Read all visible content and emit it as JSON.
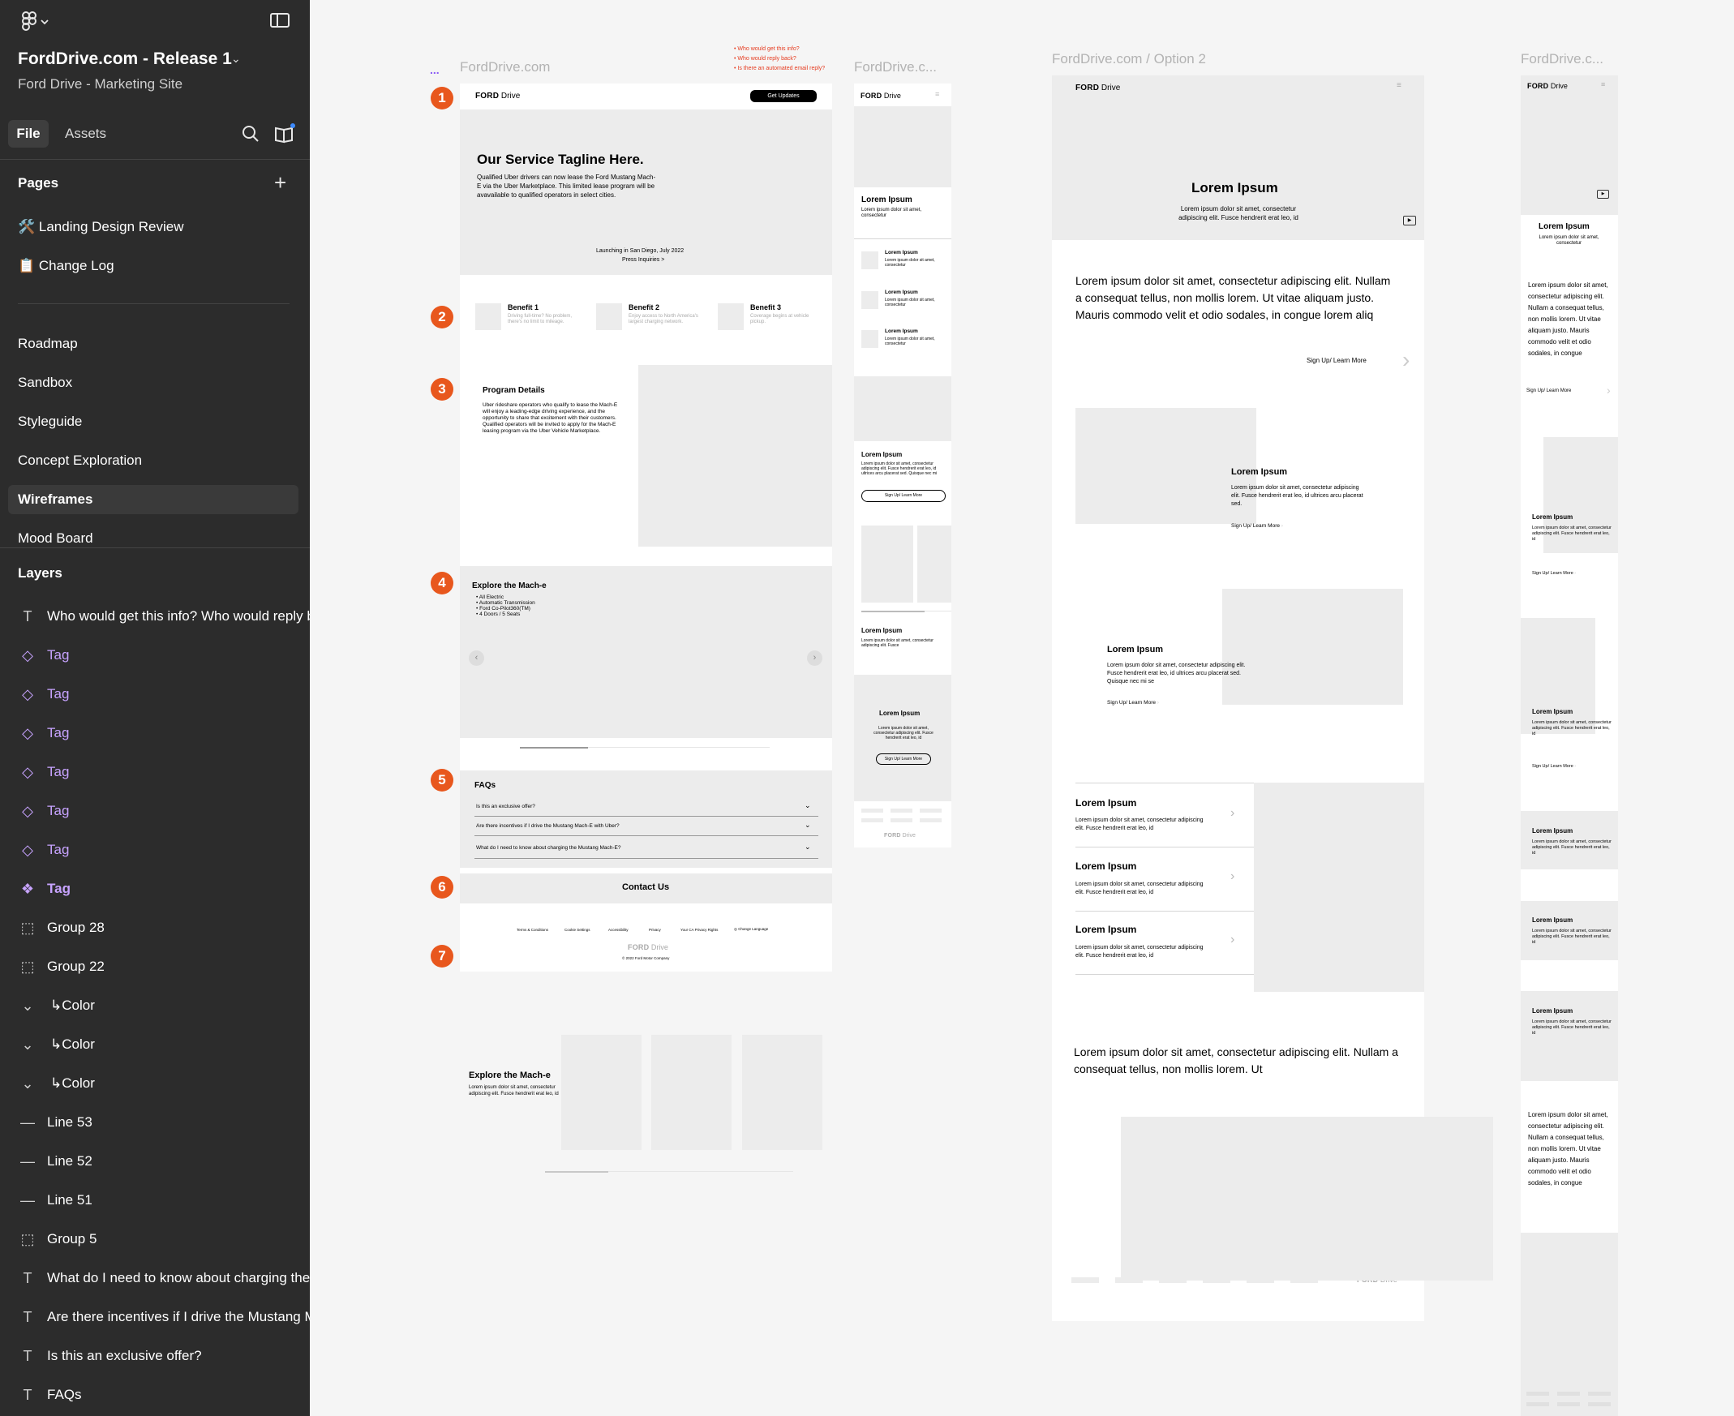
{
  "sidebar": {
    "project_title": "FordDrive.com - Release 1",
    "project_subtitle": "Ford Drive - Marketing Site",
    "tabs": {
      "file": "File",
      "assets": "Assets"
    },
    "pages_header": "Pages",
    "pages": [
      {
        "label": "🛠️ Landing Design Review"
      },
      {
        "label": "📋 Change Log"
      },
      {
        "label": "Roadmap"
      },
      {
        "label": "Sandbox"
      },
      {
        "label": "Styleguide"
      },
      {
        "label": "Concept Exploration"
      },
      {
        "label": "Wireframes",
        "selected": true
      },
      {
        "label": "Mood Board"
      }
    ],
    "layers_header": "Layers",
    "layers": [
      {
        "icon": "text-icon",
        "label": "Who would get this info? Who would reply back?"
      },
      {
        "icon": "instance-icon",
        "label": "Tag"
      },
      {
        "icon": "instance-icon",
        "label": "Tag"
      },
      {
        "icon": "instance-icon",
        "label": "Tag"
      },
      {
        "icon": "instance-icon",
        "label": "Tag"
      },
      {
        "icon": "instance-icon",
        "label": "Tag"
      },
      {
        "icon": "instance-icon",
        "label": "Tag"
      },
      {
        "icon": "component-icon",
        "label": "Tag"
      },
      {
        "icon": "group-icon",
        "label": "Group 28"
      },
      {
        "icon": "group-icon",
        "label": "Group 22"
      },
      {
        "icon": "chevron-icon",
        "label": "↳Color"
      },
      {
        "icon": "chevron-icon",
        "label": "↳Color"
      },
      {
        "icon": "chevron-icon",
        "label": "↳Color"
      },
      {
        "icon": "line-icon",
        "label": "Line 53"
      },
      {
        "icon": "line-icon",
        "label": "Line 52"
      },
      {
        "icon": "line-icon",
        "label": "Line 51"
      },
      {
        "icon": "group-icon",
        "label": "Group 5"
      },
      {
        "icon": "text-icon",
        "label": "What do I need to know about charging the Mustang Mach-E?"
      },
      {
        "icon": "text-icon",
        "label": "Are there incentives if I drive the Mustang Mach-E with Uber?"
      },
      {
        "icon": "text-icon",
        "label": "Is this an exclusive offer?"
      },
      {
        "icon": "text-icon",
        "label": "FAQs"
      }
    ]
  },
  "canvas": {
    "frame_labels": {
      "desktop": "FordDrive.com",
      "mobile": "FordDrive.c...",
      "option2": "FordDrive.com / Option 2",
      "option2_mobile": "FordDrive.c..."
    },
    "ellipsis": "...",
    "comments": [
      "• Who would get this info?",
      "• Who would reply back?",
      "• Is there an automated email reply?"
    ],
    "markers": [
      "1",
      "2",
      "3",
      "4",
      "5",
      "6",
      "7"
    ],
    "logo": {
      "ford": "FORD",
      "drive": "Drive"
    },
    "desktop": {
      "cta": "Get Updates",
      "hero_title": "Our Service Tagline Here.",
      "hero_body": "Qualified Uber drivers can now lease the Ford Mustang Mach-E via the Uber Marketplace. This limited lease program will be avavailable to qualified operators in select cities.",
      "launch_line": "Launching in San Diego, July 2022",
      "press_link": "Press Inquiries >",
      "benefits": [
        {
          "title": "Benefit 1",
          "body": "Driving full-time? No problem, there's no limit to mileage."
        },
        {
          "title": "Benefit 2",
          "body": "Enjoy access to North America's largest charging network."
        },
        {
          "title": "Benefit 3",
          "body": "Coverage begins at vehicle pickup."
        }
      ],
      "program_title": "Program Details",
      "program_body": "Uber rideshare operators who qualify to lease the Mach-E will enjoy a leading-edge driving experience, and the opportunity to share that excitement with their customers. Qualified operators will be invited to apply for the Mach-E leasing program via the Uber Vehicle Marketplace.",
      "explore_title": "Explore the Mach-e",
      "explore_bullets": [
        "All Electric",
        "Automatic Transmission",
        "Ford Co-Pilot360(TM)",
        "4 Doors / 5 Seats"
      ],
      "faq_title": "FAQs",
      "faqs": [
        "Is this an exclusive offer?",
        "Are there incentives if I drive the Mustang Mach-E with Uber?",
        "What do I need to know about charging the Mustang Mach-E?"
      ],
      "contact": "Contact Us",
      "footer_links": [
        "Terms & Conditions",
        "Cookie Settings",
        "Accessibility",
        "Privacy",
        "Your CA Privacy Rights",
        "Change Language"
      ],
      "copyright": "© 2022 Ford Motor Company",
      "explore2_title": "Explore the Mach-e",
      "explore2_body": "Lorem ipsum dolor sit amet, consectetur adipiscing elit. Fusce hendrerit erat leo, id"
    },
    "mobile": {
      "hero_title": "Lorem Ipsum",
      "hero_body": "Lorem ipsum dolor sit amet, consectetur",
      "items": [
        {
          "title": "Lorem Ipsum",
          "body": "Lorem ipsum dolor sit amet, consectetur"
        },
        {
          "title": "Lorem Ipsum",
          "body": "Lorem ipsum dolor sit amet, consectetur"
        },
        {
          "title": "Lorem Ipsum",
          "body": "Lorem ipsum dolor sit amet, consectetur"
        }
      ],
      "sec_title": "Lorem Ipsum",
      "sec_body": "Lorem ipsum dolor sit amet, consectetur adipiscing elit. Fusce hendrerit erat leo, id ultrices arcu placerat sed. Quisque nec mi",
      "sec_btn": "Sign Up/ Learn More",
      "sec2_title": "Lorem Ipsum",
      "sec2_body": "Lorem ipsum dolor sit amet, consectetur adipiscing elit. Fusce",
      "sec3_title": "Lorem Ipsum",
      "sec3_body": "Lorem ipsum dolor sit amet, consectetur adipiscing elit. Fusce hendrerit erat leo, id",
      "sec3_btn": "Sign Up/ Learn More"
    },
    "option2": {
      "hero_title": "Lorem Ipsum",
      "hero_body": "Lorem ipsum dolor sit amet, consectetur adipiscing elit. Fusce hendrerit erat leo, id",
      "intro": "Lorem ipsum dolor sit amet, consectetur adipiscing elit. Nullam a consequat tellus, non mollis lorem. Ut vitae aliquam justo. Mauris commodo velit et odio sodales, in congue lorem aliq",
      "intro_link": "Sign Up/ Learn More",
      "feat1_title": "Lorem Ipsum",
      "feat1_body": "Lorem ipsum dolor sit amet, consectetur adipiscing elit. Fusce hendrerit erat leo, id ultrices arcu placerat sed.",
      "feat1_link": "Sign Up/ Learn More",
      "feat2_title": "Lorem Ipsum",
      "feat2_body": "Lorem ipsum dolor sit amet, consectetur adipiscing elit. Fusce hendrerit erat leo, id ultrices arcu placerat sed. Quisque nec mi se",
      "feat2_link": "Sign Up/ Learn More",
      "list": [
        {
          "title": "Lorem Ipsum",
          "body": "Lorem ipsum dolor sit amet, consectetur adipiscing elit. Fusce hendrerit erat leo, id"
        },
        {
          "title": "Lorem Ipsum",
          "body": "Lorem ipsum dolor sit amet, consectetur adipiscing elit. Fusce hendrerit erat leo, id"
        },
        {
          "title": "Lorem Ipsum",
          "body": "Lorem ipsum dolor sit amet, consectetur adipiscing elit. Fusce hendrerit erat leo, id"
        }
      ],
      "outro": "Lorem ipsum dolor sit amet, consectetur adipiscing elit. Nullam a consequat tellus, non mollis lorem. Ut"
    },
    "option2_mobile": {
      "hero_title": "Lorem Ipsum",
      "hero_body": "Lorem ipsum dolor sit amet, consectetur",
      "intro": "Lorem ipsum dolor sit amet, consectetur adipiscing elit. Nullam a consequat tellus, non mollis lorem. Ut vitae aliquam justo. Mauris commodo velit et odio sodales, in congue",
      "link": "Sign Up/ Learn More",
      "cards": [
        {
          "title": "Lorem Ipsum",
          "body": "Lorem ipsum dolor sit amet, consectetur adipiscing elit. Fusce hendrerit erat leo, id",
          "link": "Sign Up/ Learn More"
        },
        {
          "title": "Lorem Ipsum",
          "body": "Lorem ipsum dolor sit amet, consectetur adipiscing elit. Fusce hendrerit erat leo, id",
          "link": "Sign Up/ Learn More"
        },
        {
          "title": "Lorem Ipsum",
          "body": "Lorem ipsum dolor sit amet, consectetur adipiscing elit. Fusce hendrerit erat leo, id"
        },
        {
          "title": "Lorem Ipsum",
          "body": "Lorem ipsum dolor sit amet, consectetur adipiscing elit. Fusce hendrerit erat leo, id"
        },
        {
          "title": "Lorem Ipsum",
          "body": "Lorem ipsum dolor sit amet, consectetur adipiscing elit. Fusce hendrerit erat leo, id"
        }
      ],
      "outro": "Lorem ipsum dolor sit amet, consectetur adipiscing elit. Nullam a consequat tellus, non mollis lorem. Ut vitae aliquam justo. Mauris commodo velit et odio sodales, in congue"
    }
  },
  "colors": {
    "sidebar_bg": "#2c2c2c",
    "canvas_bg": "#f5f5f5",
    "marker": "#e8571d",
    "component_purple": "#c7a3ff",
    "comment_red": "#e63b1f"
  }
}
